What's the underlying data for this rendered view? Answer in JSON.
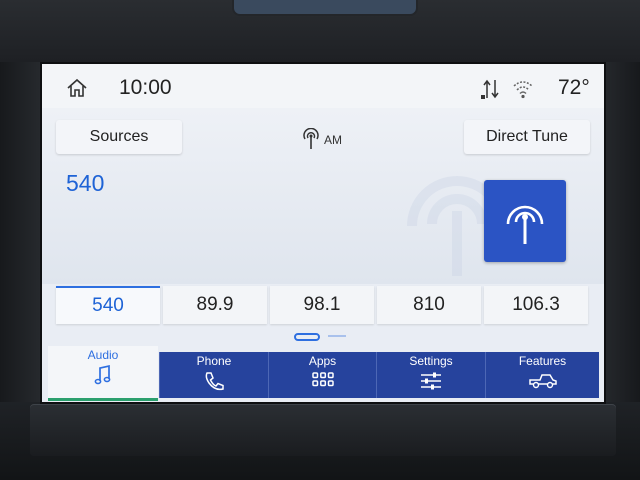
{
  "status": {
    "time": "10:00",
    "temperature": "72°"
  },
  "source": {
    "sources_label": "Sources",
    "direct_tune_label": "Direct Tune",
    "band": "AM",
    "frequency": "540"
  },
  "presets": [
    "540",
    "89.9",
    "98.1",
    "810",
    "106.3"
  ],
  "active_preset_index": 0,
  "nav": {
    "tabs": [
      {
        "label": "Audio",
        "icon": "music-note-icon"
      },
      {
        "label": "Phone",
        "icon": "phone-icon"
      },
      {
        "label": "Apps",
        "icon": "apps-grid-icon"
      },
      {
        "label": "Settings",
        "icon": "sliders-icon"
      },
      {
        "label": "Features",
        "icon": "truck-icon"
      }
    ]
  },
  "colors": {
    "accent": "#1e63d6",
    "nav_blue": "#26439d",
    "active_underline": "#2b9f6e"
  }
}
